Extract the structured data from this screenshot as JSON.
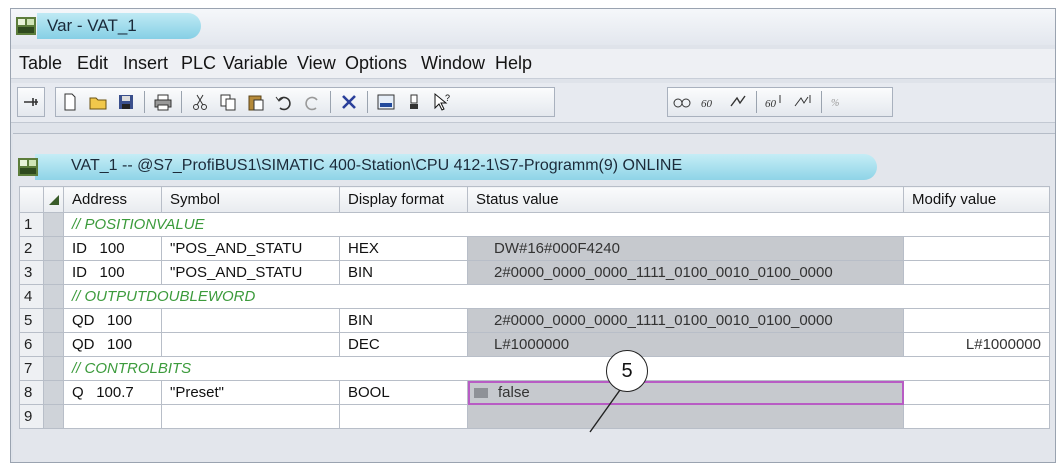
{
  "window": {
    "title": "Var - VAT_1"
  },
  "menu": [
    "Table",
    "Edit",
    "Insert",
    "PLC",
    "Variable",
    "View",
    "Options",
    "Window",
    "Help"
  ],
  "toolbar": {
    "icons": [
      "pin-icon",
      "new-icon",
      "open-icon",
      "save-icon",
      "print-icon",
      "cut-icon",
      "copy-icon",
      "paste-icon",
      "undo-icon",
      "redo-icon",
      "delete-icon",
      "monitor-icon",
      "force-icon",
      "help-cursor-icon",
      "glasses-icon",
      "monitor-variable-icon",
      "modify-variable-icon",
      "trigger-monitor-icon",
      "trigger-modify-icon",
      "activate-modify-icon"
    ]
  },
  "table_window": {
    "caption": "VAT_1 -- @S7_ProfiBUS1\\SIMATIC 400-Station\\CPU 412-1\\S7-Programm(9)  ONLINE",
    "columns": [
      "Address",
      "Symbol",
      "Display format",
      "Status value",
      "Modify value"
    ],
    "rows": [
      {
        "n": "1",
        "comment": "// POSITIONVALUE"
      },
      {
        "n": "2",
        "op": "ID",
        "addr": "100",
        "symbol": "\"POS_AND_STATU",
        "format": "HEX",
        "status": "DW#16#000F4240",
        "modify": ""
      },
      {
        "n": "3",
        "op": "ID",
        "addr": "100",
        "symbol": "\"POS_AND_STATU",
        "format": "BIN",
        "status": "2#0000_0000_0000_1111_0100_0010_0100_0000",
        "modify": ""
      },
      {
        "n": "4",
        "comment": "// OUTPUTDOUBLEWORD"
      },
      {
        "n": "5",
        "op": "QD",
        "addr": "100",
        "symbol": "",
        "format": "BIN",
        "status": "2#0000_0000_0000_1111_0100_0010_0100_0000",
        "modify": ""
      },
      {
        "n": "6",
        "op": "QD",
        "addr": "100",
        "symbol": "",
        "format": "DEC",
        "status": "L#1000000",
        "modify": "L#1000000"
      },
      {
        "n": "7",
        "comment": "// CONTROLBITS"
      },
      {
        "n": "8",
        "op": "Q",
        "addr": "100.7",
        "symbol": "\"Preset\"",
        "format": "BOOL",
        "status": "false",
        "modify": ""
      },
      {
        "n": "9",
        "op": "",
        "addr": "",
        "symbol": "",
        "format": "",
        "status": "",
        "modify": ""
      }
    ]
  },
  "callout": {
    "label": "5"
  },
  "colors": {
    "comment": "#3c9b3c",
    "selection": "#b85cc4",
    "title_pill": "#86cfe5",
    "status_bg": "#c6c9ce"
  }
}
